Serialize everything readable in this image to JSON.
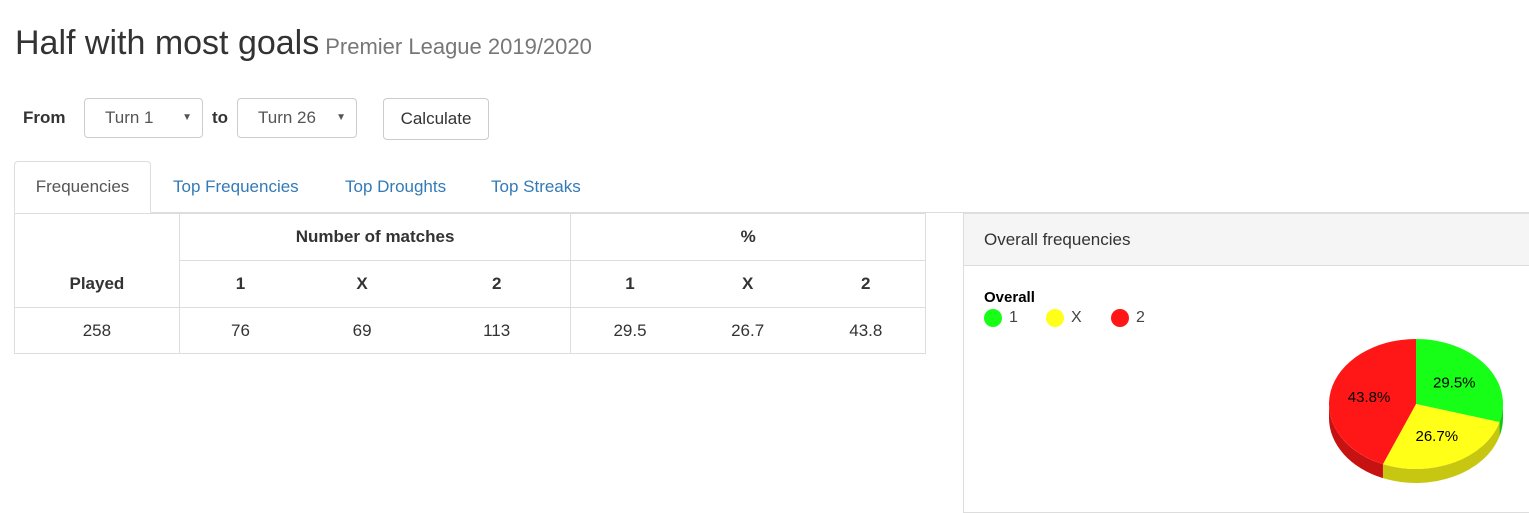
{
  "header": {
    "title": "Half with most goals",
    "subtitle": "Premier League 2019/2020"
  },
  "filters": {
    "from_label": "From",
    "from_value": "Turn 1",
    "to_label": "to",
    "to_value": "Turn 26",
    "calculate_label": "Calculate"
  },
  "tabs": [
    {
      "label": "Frequencies",
      "active": true
    },
    {
      "label": "Top Frequencies",
      "active": false
    },
    {
      "label": "Top Droughts",
      "active": false
    },
    {
      "label": "Top Streaks",
      "active": false
    }
  ],
  "table": {
    "group_headers": {
      "matches": "Number of matches",
      "percent": "%"
    },
    "played_header": "Played",
    "sub_headers": [
      "1",
      "X",
      "2",
      "1",
      "X",
      "2"
    ],
    "row": {
      "played": "258",
      "values": [
        "76",
        "69",
        "113",
        "29.5",
        "26.7",
        "43.8"
      ]
    }
  },
  "panel": {
    "title": "Overall frequencies",
    "legend_title": "Overall",
    "legend": [
      {
        "label": "1",
        "color": "#17ff17"
      },
      {
        "label": "X",
        "color": "#ffff17"
      },
      {
        "label": "2",
        "color": "#ff1717"
      }
    ]
  },
  "chart_data": {
    "type": "pie",
    "title": "Overall",
    "categories": [
      "1",
      "X",
      "2"
    ],
    "values": [
      29.5,
      26.7,
      43.8
    ],
    "labels": [
      "29.5%",
      "26.7%",
      "43.8%"
    ],
    "colors": [
      "#17ff17",
      "#ffff17",
      "#ff1717"
    ],
    "legend": "top-left"
  }
}
